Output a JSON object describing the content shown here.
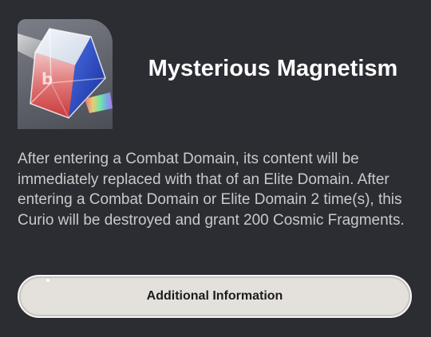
{
  "curio": {
    "title": "Mysterious Magnetism",
    "icon": "crystal-cube-icon",
    "description": "After entering a Combat Domain, its content will be immediately replaced with that of an Elite Domain. After entering a Combat Domain or Elite Domain 2 time(s), this Curio will be destroyed and grant 200 Cosmic Fragments."
  },
  "actions": {
    "additional_info_label": "Additional Information"
  },
  "colors": {
    "background": "#2c2d32",
    "title": "#ffffff",
    "description": "#c9c9cb",
    "button_fill": "#e4e1dc",
    "button_text": "#1c1c1c"
  }
}
